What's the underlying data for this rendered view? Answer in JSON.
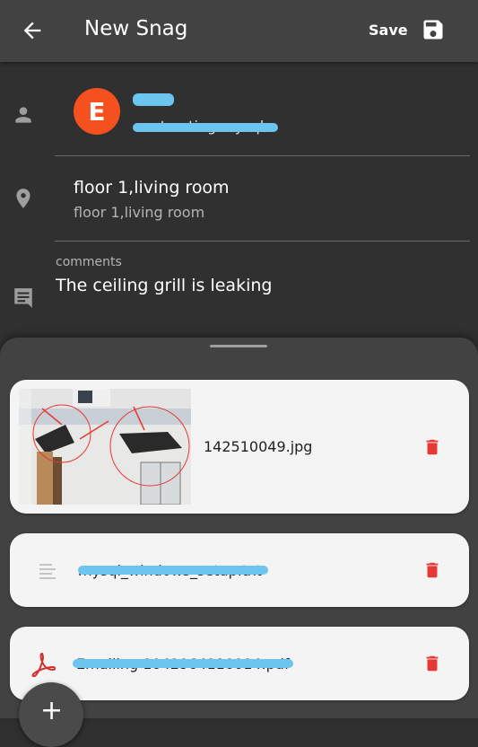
{
  "appbar": {
    "back_icon": "arrow-back-icon",
    "title": "New Snag",
    "save_label": "Save",
    "save_icon": "floppy-disk-icon"
  },
  "assignee": {
    "icon": "person-icon",
    "avatar_letter": "E",
    "avatar_color": "#f4511e",
    "subtitle": "contracting mysql"
  },
  "location": {
    "icon": "location-pin-icon",
    "title": "floor 1,living room",
    "subtitle": "floor 1,living room"
  },
  "comments": {
    "icon": "comment-icon",
    "label": "comments",
    "text": "The ceiling grill is leaking"
  },
  "attachments": [
    {
      "type": "image",
      "name": "142510049.jpg",
      "delete_icon": "trash-icon"
    },
    {
      "type": "text",
      "name": "mysql_windows_setup.txt",
      "icon": "text-file-icon",
      "delete_icon": "trash-icon"
    },
    {
      "type": "pdf",
      "name": "Emailing 1042964110014.pdf",
      "icon": "pdf-icon",
      "delete_icon": "trash-icon"
    }
  ],
  "fab": {
    "label": "+"
  },
  "colors": {
    "accent_red": "#e53935",
    "redaction": "#6cc5ef"
  }
}
